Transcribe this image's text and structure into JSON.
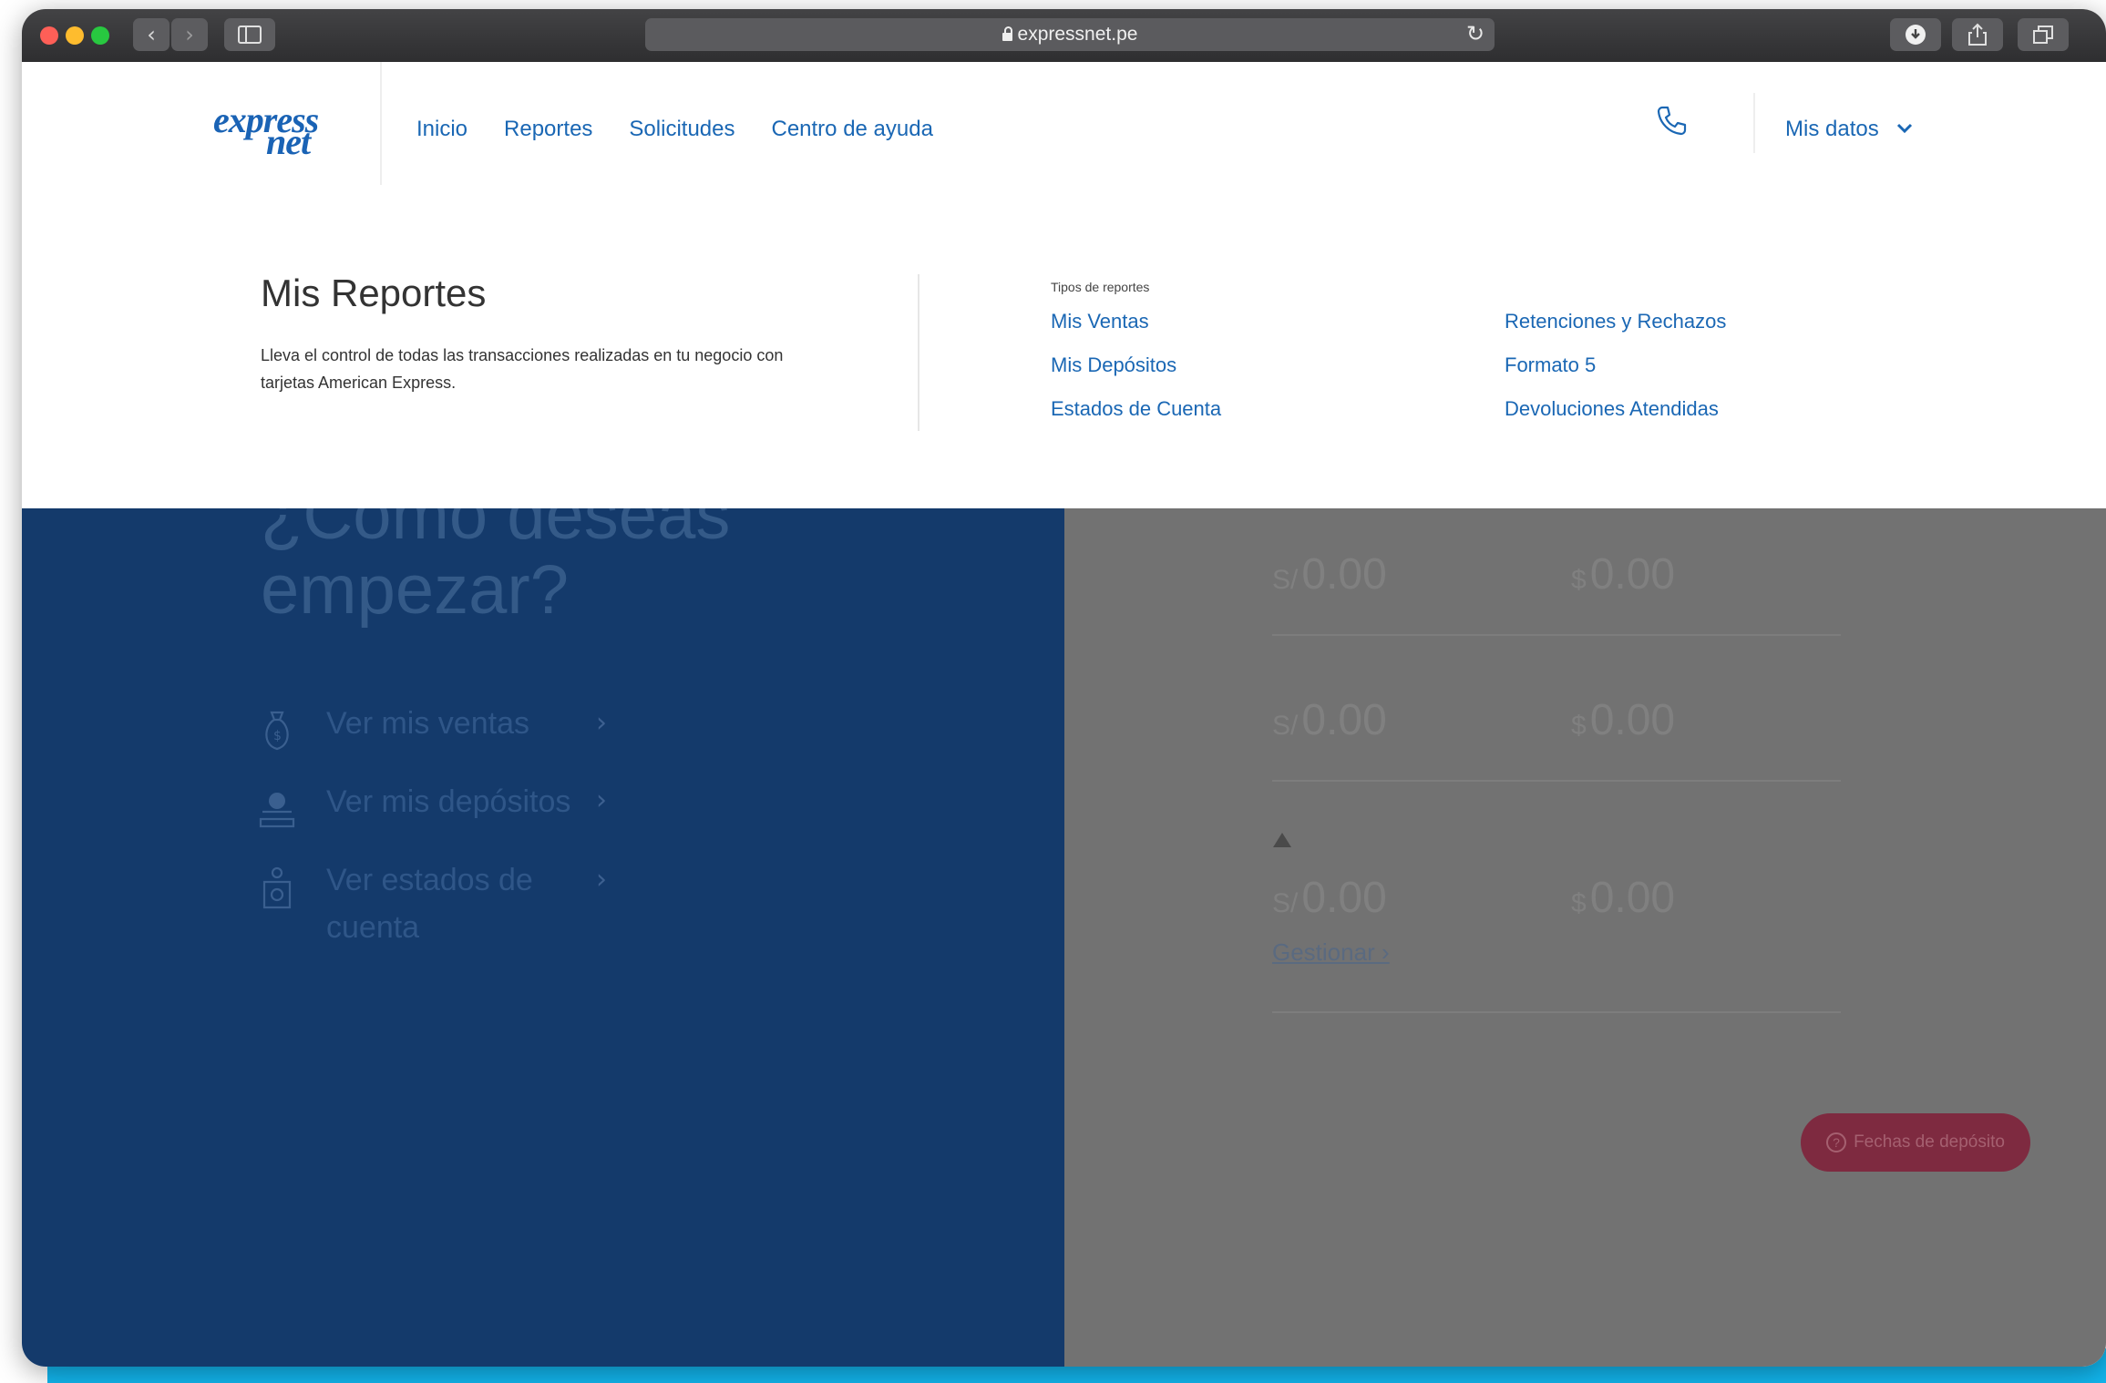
{
  "browser": {
    "url": "expressnet.pe",
    "back_icon": "chevron-left-icon",
    "forward_icon": "chevron-right-icon",
    "sidebar_icon": "sidebar-icon",
    "reload_icon": "reload-icon",
    "download_icon": "download-icon",
    "share_icon": "share-icon",
    "tabs_icon": "tabs-icon",
    "colors": {
      "close": "#fe5f57",
      "minimize": "#febc2e",
      "zoom": "#28c840"
    }
  },
  "header": {
    "logo_top": "express",
    "logo_bottom": "net",
    "nav": [
      "Inicio",
      "Reportes",
      "Solicitudes",
      "Centro de ayuda"
    ],
    "phone_icon": "phone-icon",
    "account_label": "Mis datos"
  },
  "menu": {
    "title": "Mis Reportes",
    "description": "Lleva el control de todas las transacciones realizadas en tu negocio con tarjetas American Express.",
    "subtitle": "Tipos de reportes",
    "links_col1": [
      "Mis Ventas",
      "Mis Depósitos",
      "Estados de Cuenta"
    ],
    "links_col2": [
      "Retenciones y Rechazos",
      "Formato 5",
      "Devoluciones Atendidas"
    ]
  },
  "hero": {
    "question_line1": "¿Cómo deseas",
    "question_line2": "empezar?",
    "items": [
      "Ver mis ventas",
      "Ver mis depósitos",
      "Ver estados de cuenta"
    ],
    "item_icons": [
      "money-bag-icon",
      "deposit-icon",
      "statement-icon"
    ]
  },
  "summary": {
    "rows": [
      {
        "soles_symbol": "S/",
        "soles": "0.00",
        "usd_symbol": "$",
        "usd": "0.00"
      },
      {
        "soles_symbol": "S/",
        "soles": "0.00",
        "usd_symbol": "$",
        "usd": "0.00"
      },
      {
        "soles_symbol": "S/",
        "soles": "0.00",
        "usd_symbol": "$",
        "usd": "0.00"
      }
    ],
    "manage_label": "Gestionar",
    "deposit_dates_label": "Fechas de depósito",
    "help_icon": "question-icon"
  }
}
